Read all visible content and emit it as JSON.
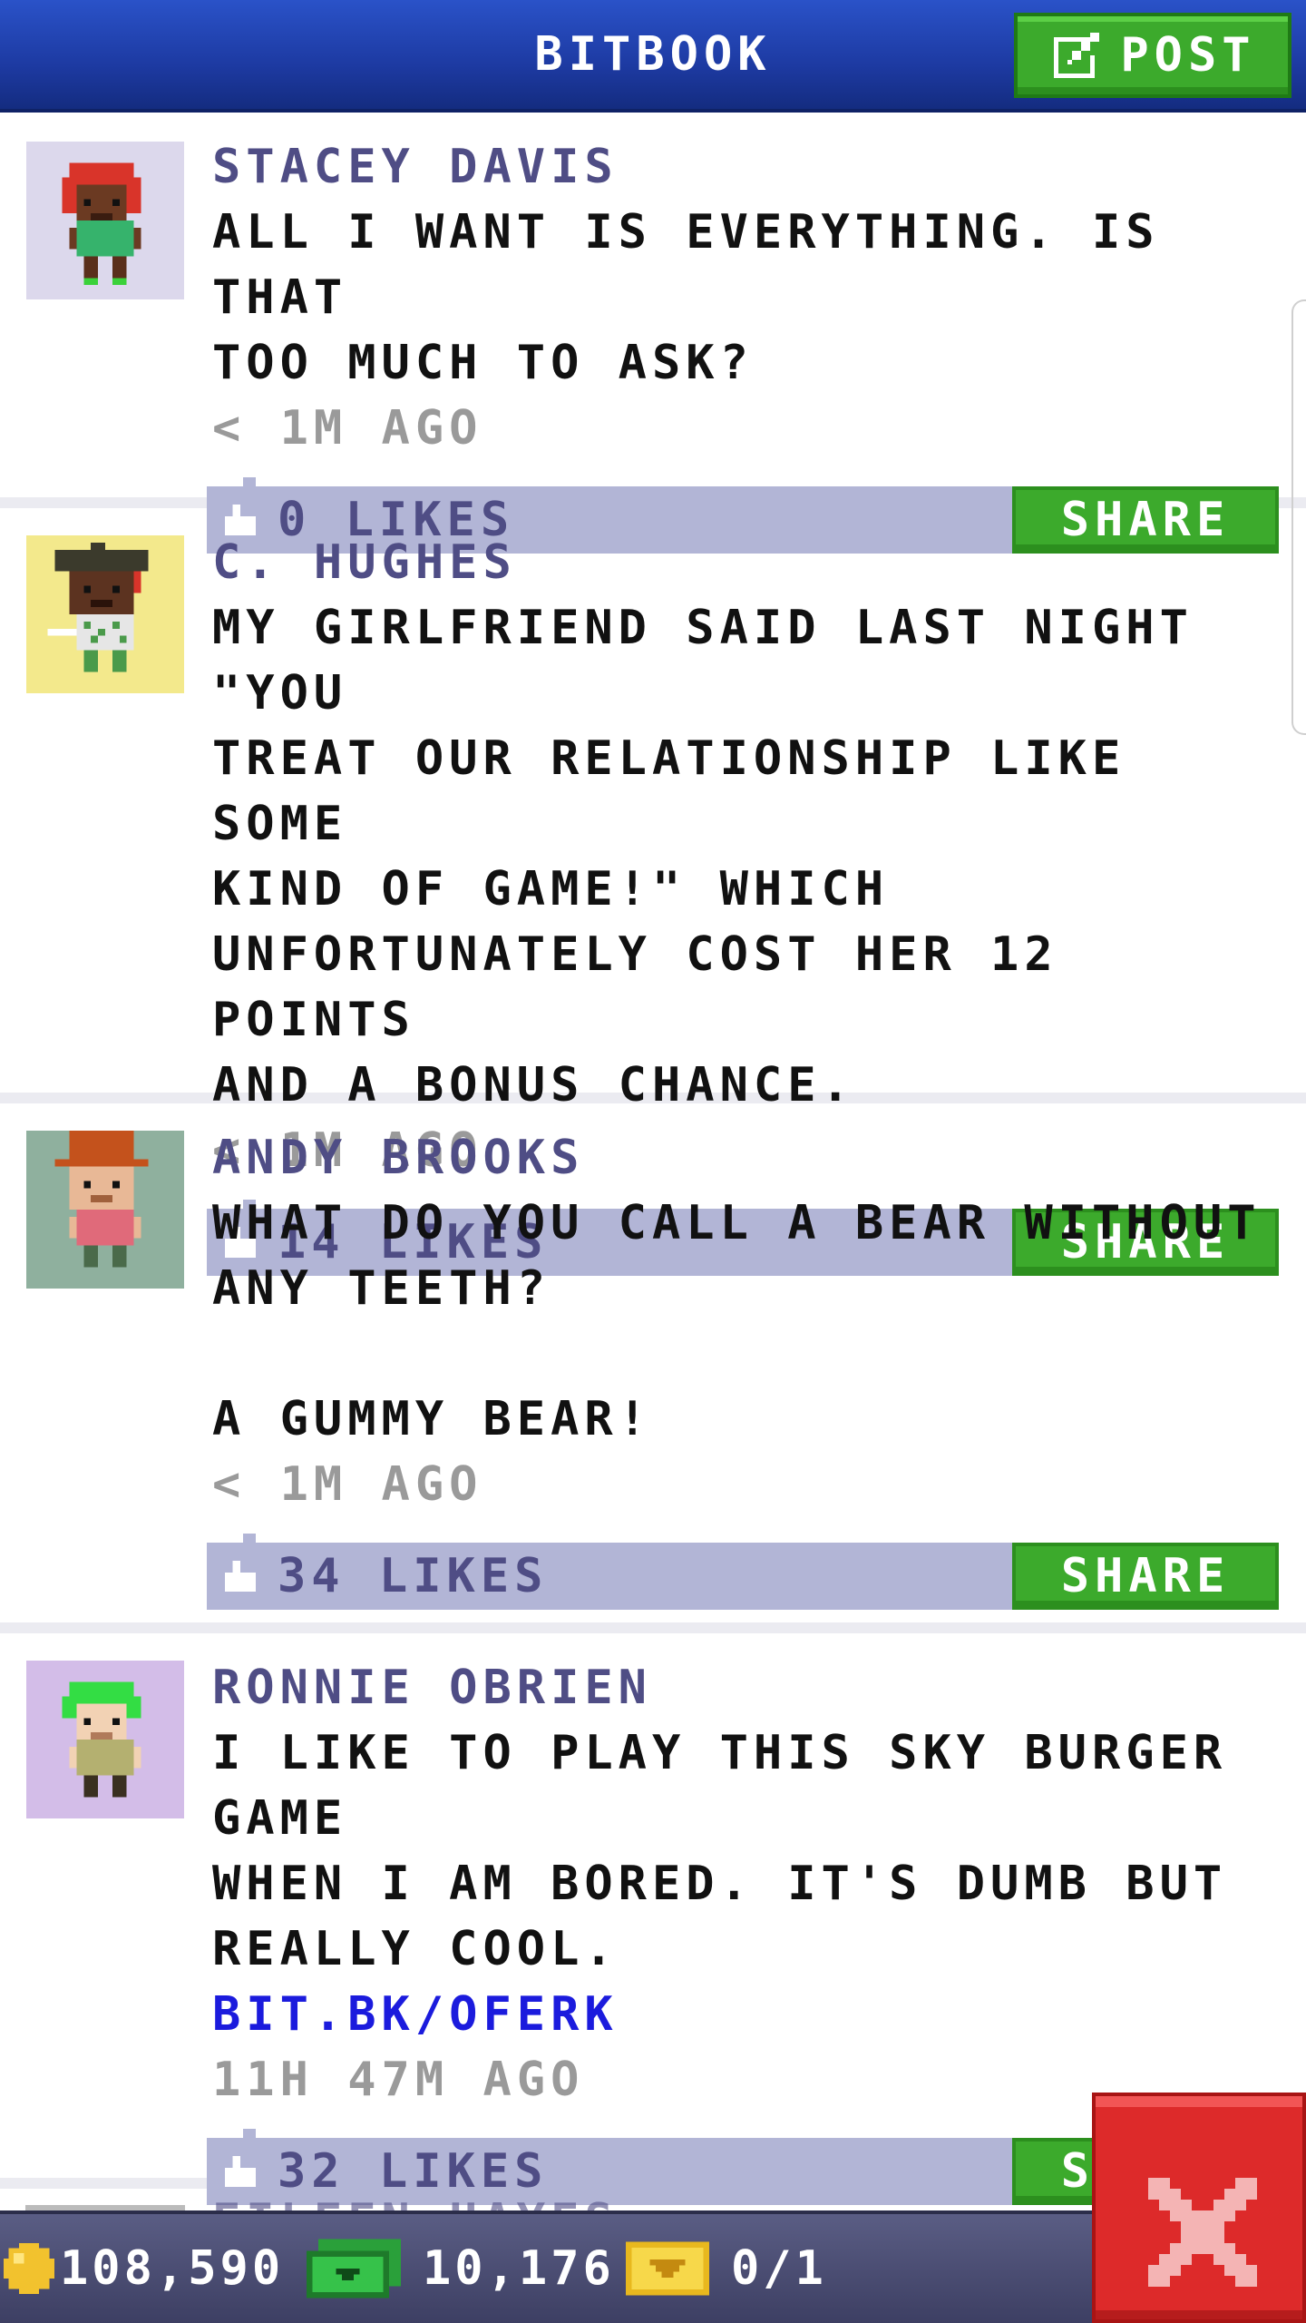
{
  "header": {
    "title": "BITBOOK",
    "post_label": "POST"
  },
  "posts": [
    {
      "author": "STACEY DAVIS",
      "text": "ALL I WANT IS EVERYTHING. IS THAT\nTOO MUCH TO ASK?",
      "link": "",
      "time": "< 1M AGO",
      "likes": "0 LIKES",
      "share_label": "SHARE",
      "avatar_bg": "#dcd8ec"
    },
    {
      "author": "C. HUGHES",
      "text": "MY GIRLFRIEND SAID LAST NIGHT \"YOU\nTREAT OUR RELATIONSHIP LIKE SOME\nKIND OF GAME!\" WHICH\nUNFORTUNATELY COST HER 12 POINTS\nAND A BONUS CHANCE.",
      "link": "",
      "time": "< 1M AGO",
      "likes": "14 LIKES",
      "share_label": "SHARE",
      "avatar_bg": "#f3e98c"
    },
    {
      "author": "ANDY BROOKS",
      "text": "WHAT DO YOU CALL A BEAR WITHOUT\nANY TEETH?\n\nA GUMMY BEAR!",
      "link": "",
      "time": "< 1M AGO",
      "likes": "34 LIKES",
      "share_label": "SHARE",
      "avatar_bg": "#8fb09e"
    },
    {
      "author": "RONNIE OBRIEN",
      "text": "I LIKE TO PLAY THIS SKY BURGER GAME\nWHEN I AM BORED. IT'S DUMB BUT\nREALLY COOL.",
      "link": "BIT.BK/OFERK",
      "time": "11H 47M AGO",
      "likes": "32 LIKES",
      "share_label": "SHARE",
      "avatar_bg": "#d3bde8"
    }
  ],
  "peek_author": "EILEEN HAYES",
  "bottom_bar": {
    "coins": "108,590",
    "bux": "10,176",
    "tickets": "0/1"
  },
  "colors": {
    "header": "#1d3aa2",
    "accent_green": "#3caa2c",
    "likes_bar": "#b2b5d6",
    "author": "#4f4d85",
    "link": "#1b1bdd",
    "close": "#dd2a2a"
  },
  "icons": [
    "edit-icon",
    "like-icon",
    "coin-icon",
    "bux-icon",
    "ticket-icon",
    "close-icon"
  ]
}
